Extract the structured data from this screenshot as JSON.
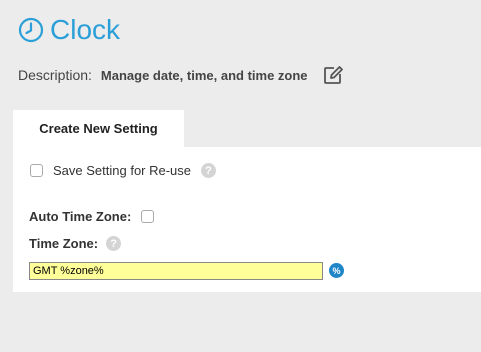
{
  "app": {
    "title": "Clock"
  },
  "description": {
    "label": "Description:",
    "text": "Manage date, time, and time zone"
  },
  "tabs": [
    {
      "label": "Create New Setting",
      "active": true
    }
  ],
  "settings": {
    "save_reuse": {
      "label": "Save Setting for Re-use",
      "checked": false
    },
    "auto_time_zone": {
      "label": "Auto Time Zone:",
      "checked": false
    },
    "time_zone": {
      "label": "Time Zone:",
      "value": "GMT %zone%"
    },
    "variable_button": "%"
  },
  "help_glyph": "?",
  "colors": {
    "accent": "#2a9fd8",
    "input_highlight": "#ffff99",
    "variable_button": "#1f86c8",
    "background": "#ececec"
  },
  "icons": [
    "clock-icon",
    "edit-icon",
    "help-icon",
    "variable-icon"
  ]
}
